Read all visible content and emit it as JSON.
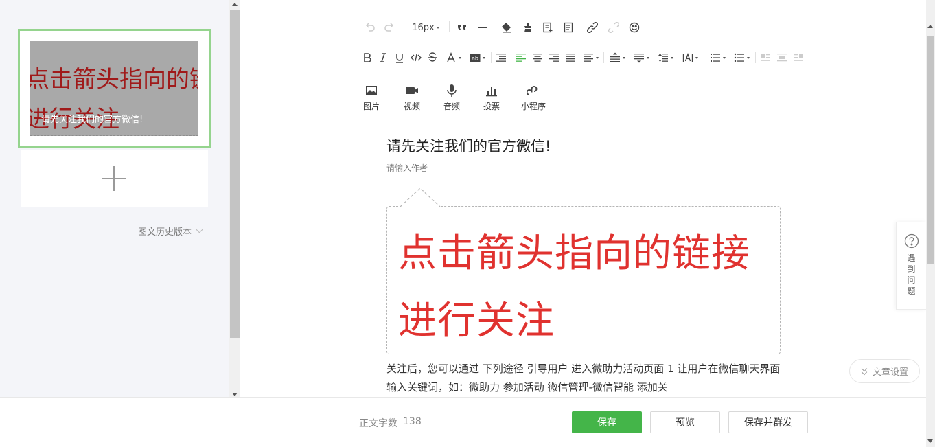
{
  "left_panel": {
    "thumb_big_line1": "点击箭头指向的链接",
    "thumb_big_line2": "进行关注",
    "thumb_title": "请先关注我们的官方微信!",
    "history_label": "图文历史版本"
  },
  "toolbar": {
    "font_size": "16px",
    "media": {
      "image": "图片",
      "video": "视频",
      "audio": "音频",
      "vote": "投票",
      "miniprogram": "小程序"
    }
  },
  "editor": {
    "title": "请先关注我们的官方微信!",
    "author_placeholder": "请输入作者",
    "big_line1": "点击箭头指向的链接",
    "big_line2": "进行关注",
    "body": "关注后，您可以通过 下列途径 引导用户 进入微助力活动页面 1 让用户在微信聊天界面输入关键词，如：微助力   参加活动   微信管理-微信智能 添加关"
  },
  "help_widget": {
    "label": "遇到问题"
  },
  "settings_button": "文章设置",
  "bottom_bar": {
    "word_count_label": "正文字数",
    "word_count_value": "138",
    "save": "保存",
    "preview": "预览",
    "save_and_send": "保存并群发"
  },
  "colors": {
    "accent_green": "#44b549",
    "selected_border": "#95d48e",
    "headline_red": "#e0322f",
    "align_active": "#44b549"
  }
}
